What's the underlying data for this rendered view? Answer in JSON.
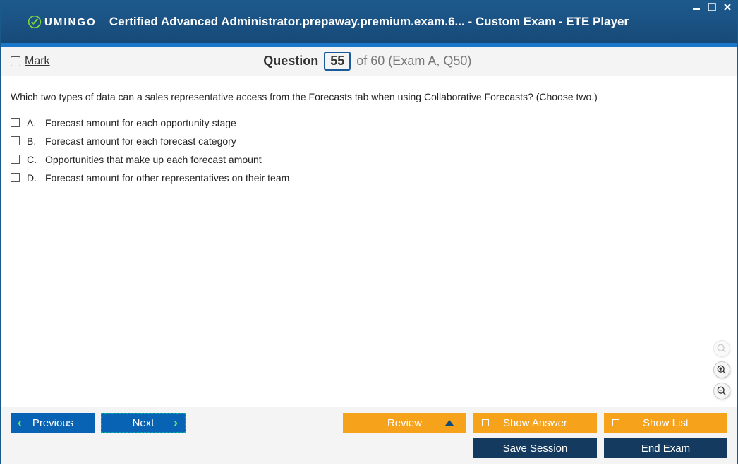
{
  "brand": "UMINGO",
  "windowTitle": "Certified Advanced Administrator.prepaway.premium.exam.6... - Custom Exam - ETE Player",
  "markLabel": "Mark",
  "questionWord": "Question",
  "questionNumber": "55",
  "questionTotal": "of 60 (Exam A, Q50)",
  "questionText": "Which two types of data can a sales representative access from the Forecasts tab when using Collaborative Forecasts? (Choose two.)",
  "options": [
    {
      "letter": "A.",
      "text": "Forecast amount for each opportunity stage"
    },
    {
      "letter": "B.",
      "text": "Forecast amount for each forecast category"
    },
    {
      "letter": "C.",
      "text": "Opportunities that make up each forecast amount"
    },
    {
      "letter": "D.",
      "text": "Forecast amount for other representatives on their team"
    }
  ],
  "buttons": {
    "previous": "Previous",
    "next": "Next",
    "review": "Review",
    "showAnswer": "Show Answer",
    "showList": "Show List",
    "saveSession": "Save Session",
    "endExam": "End Exam"
  }
}
